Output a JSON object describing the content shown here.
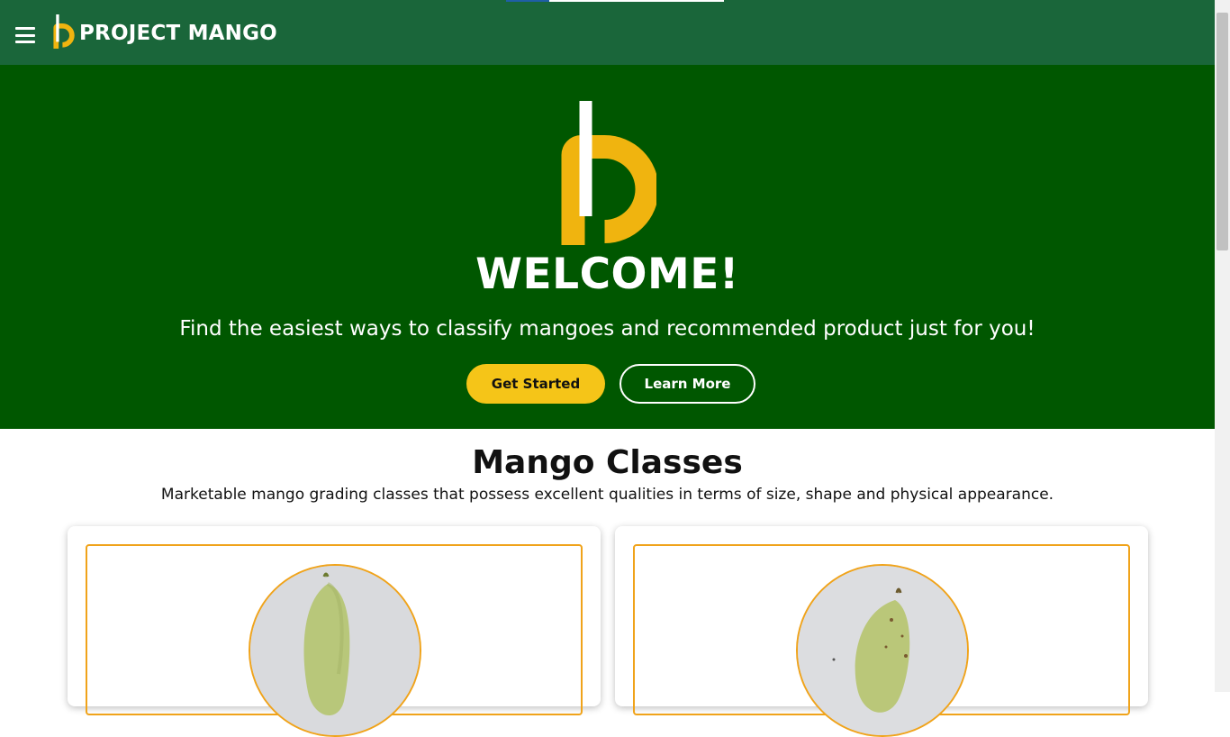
{
  "header": {
    "brand": "PROJECT MANGO",
    "menu_icon": "hamburger-menu-icon"
  },
  "hero": {
    "title": "WELCOME!",
    "subtitle": "Find the easiest ways to classify mangoes and recommended product just for you!",
    "primary_button": "Get Started",
    "secondary_button": "Learn More"
  },
  "classes": {
    "title": "Mango Classes",
    "description": "Marketable mango grading classes that possess excellent qualities in terms of size, shape and physical appearance."
  },
  "colors": {
    "header_bg": "#1a663a",
    "hero_bg": "#005700",
    "accent_yellow": "#f5c518",
    "card_border": "#f0a31a"
  }
}
